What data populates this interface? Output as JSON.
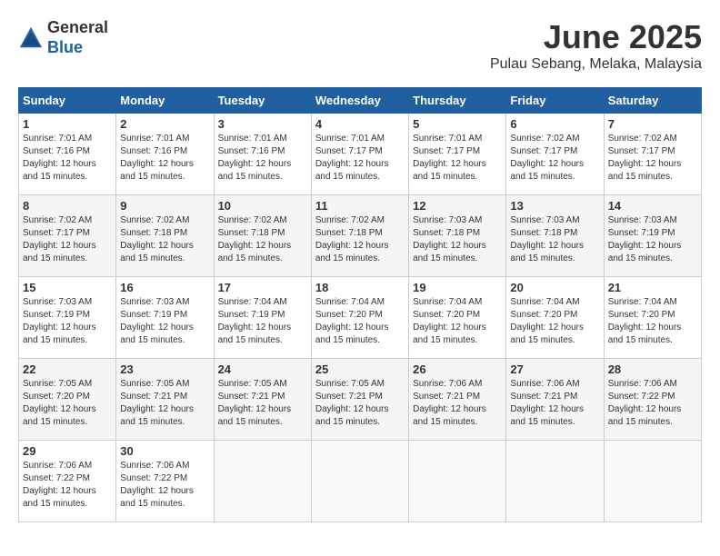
{
  "logo": {
    "general": "General",
    "blue": "Blue"
  },
  "title": "June 2025",
  "subtitle": "Pulau Sebang, Melaka, Malaysia",
  "weekdays": [
    "Sunday",
    "Monday",
    "Tuesday",
    "Wednesday",
    "Thursday",
    "Friday",
    "Saturday"
  ],
  "weeks": [
    [
      {
        "day": "1",
        "sunrise": "7:01 AM",
        "sunset": "7:16 PM",
        "daylight": "12 hours and 15 minutes."
      },
      {
        "day": "2",
        "sunrise": "7:01 AM",
        "sunset": "7:16 PM",
        "daylight": "12 hours and 15 minutes."
      },
      {
        "day": "3",
        "sunrise": "7:01 AM",
        "sunset": "7:16 PM",
        "daylight": "12 hours and 15 minutes."
      },
      {
        "day": "4",
        "sunrise": "7:01 AM",
        "sunset": "7:17 PM",
        "daylight": "12 hours and 15 minutes."
      },
      {
        "day": "5",
        "sunrise": "7:01 AM",
        "sunset": "7:17 PM",
        "daylight": "12 hours and 15 minutes."
      },
      {
        "day": "6",
        "sunrise": "7:02 AM",
        "sunset": "7:17 PM",
        "daylight": "12 hours and 15 minutes."
      },
      {
        "day": "7",
        "sunrise": "7:02 AM",
        "sunset": "7:17 PM",
        "daylight": "12 hours and 15 minutes."
      }
    ],
    [
      {
        "day": "8",
        "sunrise": "7:02 AM",
        "sunset": "7:17 PM",
        "daylight": "12 hours and 15 minutes."
      },
      {
        "day": "9",
        "sunrise": "7:02 AM",
        "sunset": "7:18 PM",
        "daylight": "12 hours and 15 minutes."
      },
      {
        "day": "10",
        "sunrise": "7:02 AM",
        "sunset": "7:18 PM",
        "daylight": "12 hours and 15 minutes."
      },
      {
        "day": "11",
        "sunrise": "7:02 AM",
        "sunset": "7:18 PM",
        "daylight": "12 hours and 15 minutes."
      },
      {
        "day": "12",
        "sunrise": "7:03 AM",
        "sunset": "7:18 PM",
        "daylight": "12 hours and 15 minutes."
      },
      {
        "day": "13",
        "sunrise": "7:03 AM",
        "sunset": "7:18 PM",
        "daylight": "12 hours and 15 minutes."
      },
      {
        "day": "14",
        "sunrise": "7:03 AM",
        "sunset": "7:19 PM",
        "daylight": "12 hours and 15 minutes."
      }
    ],
    [
      {
        "day": "15",
        "sunrise": "7:03 AM",
        "sunset": "7:19 PM",
        "daylight": "12 hours and 15 minutes."
      },
      {
        "day": "16",
        "sunrise": "7:03 AM",
        "sunset": "7:19 PM",
        "daylight": "12 hours and 15 minutes."
      },
      {
        "day": "17",
        "sunrise": "7:04 AM",
        "sunset": "7:19 PM",
        "daylight": "12 hours and 15 minutes."
      },
      {
        "day": "18",
        "sunrise": "7:04 AM",
        "sunset": "7:20 PM",
        "daylight": "12 hours and 15 minutes."
      },
      {
        "day": "19",
        "sunrise": "7:04 AM",
        "sunset": "7:20 PM",
        "daylight": "12 hours and 15 minutes."
      },
      {
        "day": "20",
        "sunrise": "7:04 AM",
        "sunset": "7:20 PM",
        "daylight": "12 hours and 15 minutes."
      },
      {
        "day": "21",
        "sunrise": "7:04 AM",
        "sunset": "7:20 PM",
        "daylight": "12 hours and 15 minutes."
      }
    ],
    [
      {
        "day": "22",
        "sunrise": "7:05 AM",
        "sunset": "7:20 PM",
        "daylight": "12 hours and 15 minutes."
      },
      {
        "day": "23",
        "sunrise": "7:05 AM",
        "sunset": "7:21 PM",
        "daylight": "12 hours and 15 minutes."
      },
      {
        "day": "24",
        "sunrise": "7:05 AM",
        "sunset": "7:21 PM",
        "daylight": "12 hours and 15 minutes."
      },
      {
        "day": "25",
        "sunrise": "7:05 AM",
        "sunset": "7:21 PM",
        "daylight": "12 hours and 15 minutes."
      },
      {
        "day": "26",
        "sunrise": "7:06 AM",
        "sunset": "7:21 PM",
        "daylight": "12 hours and 15 minutes."
      },
      {
        "day": "27",
        "sunrise": "7:06 AM",
        "sunset": "7:21 PM",
        "daylight": "12 hours and 15 minutes."
      },
      {
        "day": "28",
        "sunrise": "7:06 AM",
        "sunset": "7:22 PM",
        "daylight": "12 hours and 15 minutes."
      }
    ],
    [
      {
        "day": "29",
        "sunrise": "7:06 AM",
        "sunset": "7:22 PM",
        "daylight": "12 hours and 15 minutes."
      },
      {
        "day": "30",
        "sunrise": "7:06 AM",
        "sunset": "7:22 PM",
        "daylight": "12 hours and 15 minutes."
      },
      null,
      null,
      null,
      null,
      null
    ]
  ]
}
